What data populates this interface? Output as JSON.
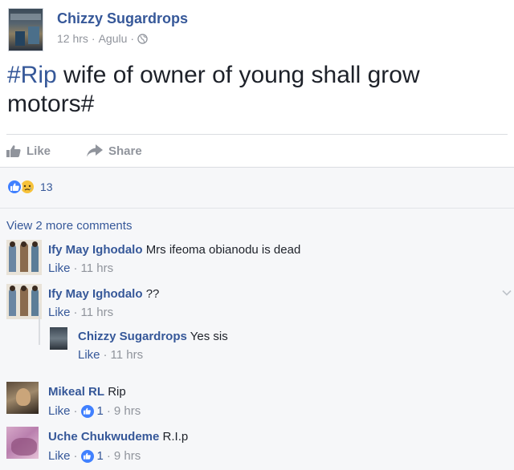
{
  "post": {
    "author": "Chizzy Sugardrops",
    "time": "12 hrs",
    "sep1": "·",
    "location": "Agulu",
    "sep2": "·",
    "text_hashtag": "#Rip",
    "text_body": " wife of owner of young shall grow motors#",
    "like_label": "Like",
    "share_label": "Share"
  },
  "reactions": {
    "count": "13"
  },
  "view_more": "View 2 more comments",
  "comments": [
    {
      "author": "Ify May Ighodalo",
      "text": "Mrs ifeoma obianodu is dead",
      "like_label": "Like",
      "sep": "·",
      "time": "11 hrs"
    },
    {
      "author": "Ify May Ighodalo",
      "text": "??",
      "like_label": "Like",
      "sep": "·",
      "time": "11 hrs"
    },
    {
      "author": "Chizzy Sugardrops",
      "text": "Yes sis",
      "like_label": "Like",
      "sep": "·",
      "time": "11 hrs"
    },
    {
      "author": "Mikeal RL",
      "text": "Rip",
      "like_label": "Like",
      "sep": "·",
      "likes": "1",
      "sep2": "·",
      "time": "9 hrs"
    },
    {
      "author": "Uche Chukwudeme",
      "text": "R.I.p",
      "like_label": "Like",
      "sep": "·",
      "likes": "1",
      "sep2": "·",
      "time": "9 hrs"
    }
  ],
  "colors": {
    "link": "#365899",
    "meta": "#90949c",
    "like_blue": "#4080ff"
  }
}
